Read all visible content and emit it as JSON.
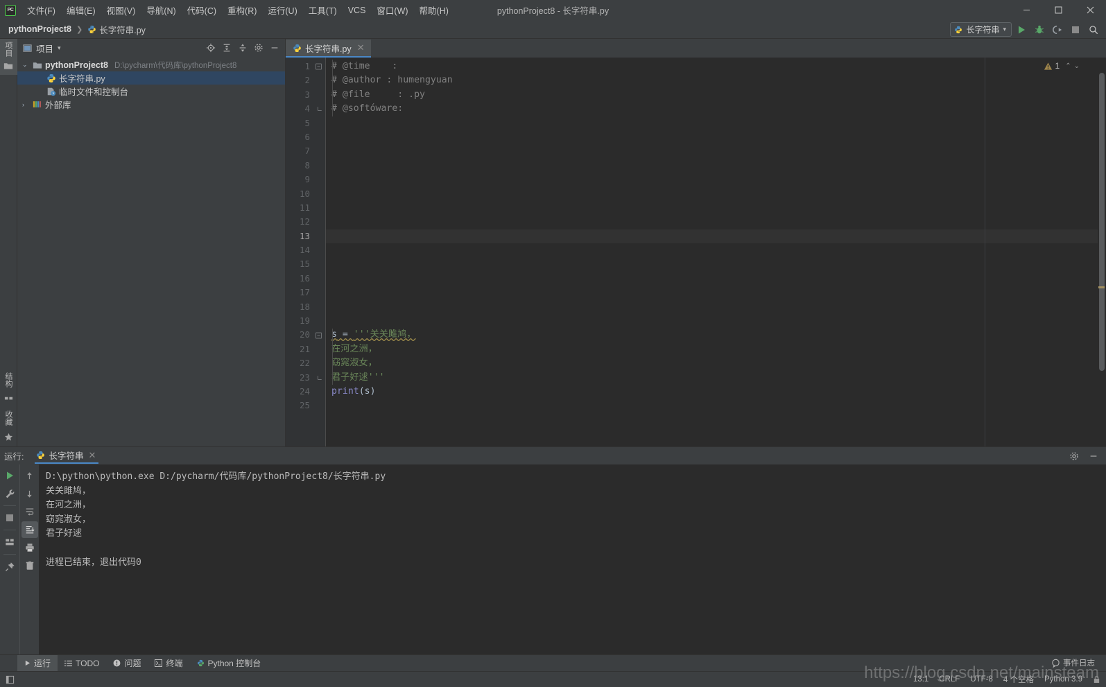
{
  "window": {
    "title": "pythonProject8 - 长字符串.py",
    "minimize": "–",
    "maximize": "□",
    "close": "X"
  },
  "menu": {
    "items": [
      {
        "label": "文件(F)",
        "name": "menu-file"
      },
      {
        "label": "编辑(E)",
        "name": "menu-edit"
      },
      {
        "label": "视图(V)",
        "name": "menu-view"
      },
      {
        "label": "导航(N)",
        "name": "menu-navigate"
      },
      {
        "label": "代码(C)",
        "name": "menu-code"
      },
      {
        "label": "重构(R)",
        "name": "menu-refactor"
      },
      {
        "label": "运行(U)",
        "name": "menu-run"
      },
      {
        "label": "工具(T)",
        "name": "menu-tools"
      },
      {
        "label": "VCS",
        "name": "menu-vcs"
      },
      {
        "label": "窗口(W)",
        "name": "menu-window"
      },
      {
        "label": "帮助(H)",
        "name": "menu-help"
      }
    ]
  },
  "navbar": {
    "project": "pythonProject8",
    "separator": "❯",
    "file": "长字符串.py",
    "run_config": "长字符串",
    "dropdown_arrow": "▾"
  },
  "project_panel": {
    "title": "项目",
    "dropdown_arrow": "▾",
    "tree": [
      {
        "label": "pythonProject8",
        "path": "D:\\pycharm\\代码库\\pythonProject8",
        "arrow": "⌄",
        "bold": true,
        "selected": false,
        "indent": 0
      },
      {
        "label": "长字符串.py",
        "path": "",
        "arrow": "",
        "bold": false,
        "selected": true,
        "indent": 1
      },
      {
        "label": "临时文件和控制台",
        "path": "",
        "arrow": "",
        "bold": false,
        "selected": false,
        "indent": 1
      },
      {
        "label": "外部库",
        "path": "",
        "arrow": "›",
        "bold": false,
        "selected": false,
        "indent": 0
      }
    ]
  },
  "left_strip": {
    "project_label": "项目",
    "structure_label": "结构",
    "favorites_label": "收藏"
  },
  "editor": {
    "tab_label": "长字符串.py",
    "tab_close": "✕",
    "warning_count": "1",
    "warn_up": "⌃",
    "warn_down": "⌄",
    "lines": [
      {
        "n": "1",
        "fold": "−",
        "segments": [
          {
            "t": "# @time    :",
            "c": "c-comment"
          }
        ]
      },
      {
        "n": "2",
        "fold": "",
        "segments": [
          {
            "t": "# @author : humengyuan",
            "c": "c-comment"
          }
        ]
      },
      {
        "n": "3",
        "fold": "",
        "segments": [
          {
            "t": "# @file     : .py",
            "c": "c-comment"
          }
        ]
      },
      {
        "n": "4",
        "fold": "⌐",
        "segments": [
          {
            "t": "# @softóware:",
            "c": "c-comment"
          }
        ]
      },
      {
        "n": "5",
        "fold": "",
        "segments": []
      },
      {
        "n": "6",
        "fold": "",
        "segments": []
      },
      {
        "n": "7",
        "fold": "",
        "segments": []
      },
      {
        "n": "8",
        "fold": "",
        "segments": []
      },
      {
        "n": "9",
        "fold": "",
        "segments": []
      },
      {
        "n": "10",
        "fold": "",
        "segments": []
      },
      {
        "n": "11",
        "fold": "",
        "segments": []
      },
      {
        "n": "12",
        "fold": "",
        "segments": []
      },
      {
        "n": "13",
        "fold": "",
        "segments": [],
        "current": true
      },
      {
        "n": "14",
        "fold": "",
        "segments": []
      },
      {
        "n": "15",
        "fold": "",
        "segments": []
      },
      {
        "n": "16",
        "fold": "",
        "segments": []
      },
      {
        "n": "17",
        "fold": "",
        "segments": []
      },
      {
        "n": "18",
        "fold": "",
        "segments": []
      },
      {
        "n": "19",
        "fold": "",
        "segments": []
      },
      {
        "n": "20",
        "fold": "−",
        "segments": [
          {
            "t": "s",
            "c": "c-var squiggle"
          },
          {
            "t": " = ",
            "c": "c-punct squiggle"
          },
          {
            "t": "'''关关雎鸠，",
            "c": "c-str squiggle"
          }
        ]
      },
      {
        "n": "21",
        "fold": "",
        "segments": [
          {
            "t": "在河之洲，",
            "c": "c-str"
          }
        ]
      },
      {
        "n": "22",
        "fold": "",
        "segments": [
          {
            "t": "窈窕淑女，",
            "c": "c-str"
          }
        ]
      },
      {
        "n": "23",
        "fold": "⌐",
        "segments": [
          {
            "t": "君子好逑'''",
            "c": "c-str"
          }
        ]
      },
      {
        "n": "24",
        "fold": "",
        "segments": [
          {
            "t": "print",
            "c": "c-fn"
          },
          {
            "t": "(s)",
            "c": "c-punct"
          }
        ]
      },
      {
        "n": "25",
        "fold": "",
        "segments": []
      }
    ]
  },
  "run_window": {
    "header_label": "运行:",
    "tab_label": "长字符串",
    "tab_close": "✕",
    "console_lines": [
      {
        "text": "D:\\python\\python.exe D:/pycharm/代码库/pythonProject8/长字符串.py",
        "cls": "con-cmd"
      },
      {
        "text": "关关雎鸠，",
        "cls": "con-cmd"
      },
      {
        "text": "在河之洲，",
        "cls": "con-cmd"
      },
      {
        "text": "窈窕淑女，",
        "cls": "con-cmd"
      },
      {
        "text": "君子好逑",
        "cls": "con-cmd"
      },
      {
        "text": "",
        "cls": "con-cmd"
      },
      {
        "text": "进程已结束，退出代码0",
        "cls": "con-cmd"
      }
    ]
  },
  "bottom_tabs": [
    {
      "label": "运行",
      "name": "bottom-tab-run",
      "active": true
    },
    {
      "label": "TODO",
      "name": "bottom-tab-todo",
      "active": false
    },
    {
      "label": "问题",
      "name": "bottom-tab-problems",
      "active": false
    },
    {
      "label": "终端",
      "name": "bottom-tab-terminal",
      "active": false
    },
    {
      "label": "Python 控制台",
      "name": "bottom-tab-python-console",
      "active": false
    }
  ],
  "status_bar": {
    "caret": "13:1",
    "line_sep": "CRLF",
    "encoding": "UTF-8",
    "indent": "4 个空格",
    "interpreter": "Python 3.9",
    "event_log": "事件日志"
  },
  "watermark": "https://blog.csdn.net/mainsteam",
  "colors": {
    "accent_blue": "#4a88c7",
    "selection": "#2f4661",
    "run_green": "#4ec94e",
    "string_green": "#6a8759",
    "comment_gray": "#808080",
    "keyword_purple": "#8888c6",
    "warning_yellow": "#a39060",
    "chrome": "#3c3f41",
    "editor_bg": "#2b2b2b",
    "gutter_bg": "#313335"
  }
}
